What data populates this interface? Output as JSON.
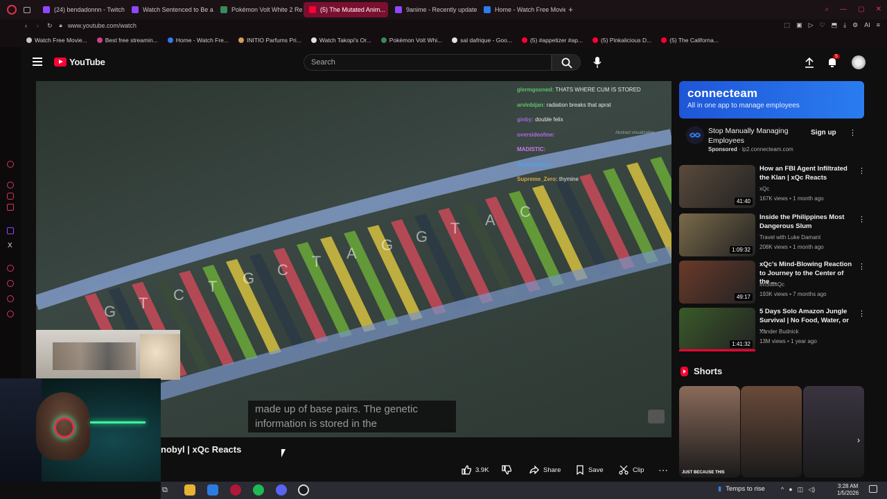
{
  "browser": {
    "tabs": [
      {
        "label": "(24) bendadonnn - Twitch",
        "color": "#9146ff"
      },
      {
        "label": "Watch Sentenced to Be a ...",
        "color": "#9146ff"
      },
      {
        "label": "Pokémon Volt White 2 Re...",
        "color": "#3a8a5a"
      },
      {
        "label": "(5) The Mutated Anim...",
        "color": "#ff0033",
        "active": true
      },
      {
        "label": "9anime - Recently update",
        "color": "#9146ff"
      },
      {
        "label": "Home - Watch Free Movie...",
        "color": "#2b7cf0"
      }
    ],
    "url": "www.youtube.com/watch",
    "bookmarks": [
      {
        "label": "Watch Free Movie...",
        "color": "#c8c8c8"
      },
      {
        "label": "Best free streamin...",
        "color": "#d04080"
      },
      {
        "label": "Home - Watch Fre...",
        "color": "#2b7cf0"
      },
      {
        "label": "INITIO Parfums Pri...",
        "color": "#d0a050"
      },
      {
        "label": "Watch Takopi's Or...",
        "color": "#e0e0e0"
      },
      {
        "label": "Pokémon Volt Whi...",
        "color": "#3a8a5a"
      },
      {
        "label": "sal dafrique - Goo...",
        "color": "#e0e0e0"
      },
      {
        "label": "(5) #appetizer #ap...",
        "color": "#ff0033"
      },
      {
        "label": "(5) Pinkalicious D...",
        "color": "#ff0033"
      },
      {
        "label": "(5) The Californa...",
        "color": "#ff0033"
      }
    ]
  },
  "youtube": {
    "logo": "YouTube",
    "search_placeholder": "Search",
    "notification_count": "5"
  },
  "video": {
    "chat": [
      {
        "user": "glermgooned:",
        "msg": "THATS WHERE CUM IS STORED",
        "color": "#5ec16b"
      },
      {
        "user": "arvinbijan:",
        "msg": "radiation breaks that aprat",
        "color": "#66c36b"
      },
      {
        "user": "ginby:",
        "msg": "double felix",
        "color": "#9a6bd8"
      },
      {
        "user": "oversideofme:",
        "msg": "",
        "color": "#b06ae6"
      },
      {
        "user": "MADISTIC:",
        "msg": "",
        "color": "#c77bf2"
      },
      {
        "user": "digenbhalles:",
        "msg": "",
        "color": "#4fa3e6"
      },
      {
        "user": "Supreme_Zero:",
        "msg": "thymine",
        "color": "#d6a84a"
      }
    ],
    "watermark": "Abstract visualization",
    "caption_line1": "made up of base pairs. The genetic",
    "caption_line2": "information is stored in the",
    "dna_letters": [
      "G",
      "T",
      "C",
      "T",
      "G",
      "C",
      "T",
      "A",
      "G",
      "G",
      "T",
      "A",
      "C"
    ]
  },
  "title": "nobyl | xQc Reacts",
  "actions": {
    "likes": "3.9K",
    "share": "Share",
    "save": "Save",
    "clip": "Clip"
  },
  "ad": {
    "brand": "connecteam",
    "tagline": "All in one app to manage employees",
    "headline": "Stop Manually Managing Employees",
    "sponsored": "Sponsored",
    "domain": "lp2.connecteam.com",
    "cta": "Sign up"
  },
  "recommendations": [
    {
      "title": "How an FBI Agent Infiltrated the Klan | xQc Reacts",
      "channel": "xQc",
      "meta": "167K views • 1 month ago",
      "duration": "41:40",
      "bg": "#5a4a3c"
    },
    {
      "title": "Inside the Philippines Most Dangerous Slum",
      "channel": "Travel with Luke Damant",
      "meta": "208K views • 1 month ago",
      "duration": "1:09:32",
      "bg": "#7a6a4a"
    },
    {
      "title": "xQc's Mind-Blowing Reaction to Journey to the Center of the ...",
      "channel": "ImStillxQc",
      "meta": "193K views • 7 months ago",
      "duration": "49:17",
      "bg": "#6a3a2a"
    },
    {
      "title": "5 Days Solo Amazon Jungle Survival | No Food, Water, or ...",
      "channel": "Xander Budnick",
      "meta": "13M views • 1 year ago",
      "duration": "1:41:32",
      "bg": "#3a5a2a"
    }
  ],
  "shorts": {
    "heading": "Shorts",
    "items": [
      {
        "bg": "#8a6a5a",
        "caption": "JUST BECAUSE THIS"
      },
      {
        "bg": "#6a4a3a",
        "caption": ""
      },
      {
        "bg": "#3a3440",
        "caption": ""
      }
    ]
  },
  "taskbar": {
    "weather": "Temps to rise",
    "time": "3:28 AM",
    "date": "1/5/2026"
  }
}
